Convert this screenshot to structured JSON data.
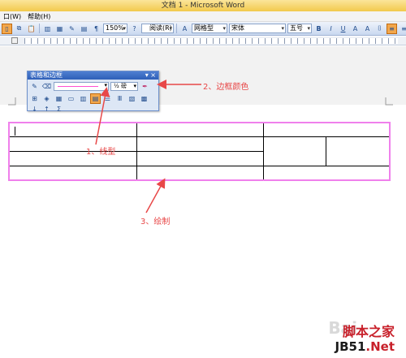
{
  "window": {
    "title": "文档 1 - Microsoft Word"
  },
  "menu": {
    "items": [
      "口(W)",
      "帮助(H)"
    ]
  },
  "toolbar": {
    "zoom": "150%",
    "read_button": "阅读(R)",
    "style": "网格型",
    "font": "宋体",
    "font_size": "五号",
    "bold": "B",
    "italic": "I",
    "underline": "U",
    "char_a": "A"
  },
  "tables_borders_toolbar": {
    "title": "表格和边框",
    "line_weight": "½ 磅",
    "line_color": "#ff4fd2",
    "close": "×",
    "menu_arrow": "▾"
  },
  "annotations": [
    {
      "label": "1、线型"
    },
    {
      "label": "2、边框颜色"
    },
    {
      "label": "3、绘制"
    }
  ],
  "watermark": {
    "baidu": "Bai",
    "site_cn": "脚本之家",
    "site_url_a": "JB51",
    "site_url_b": ".Net"
  },
  "colors": {
    "annotation": "#e84848",
    "table_border": "#f080ec"
  }
}
